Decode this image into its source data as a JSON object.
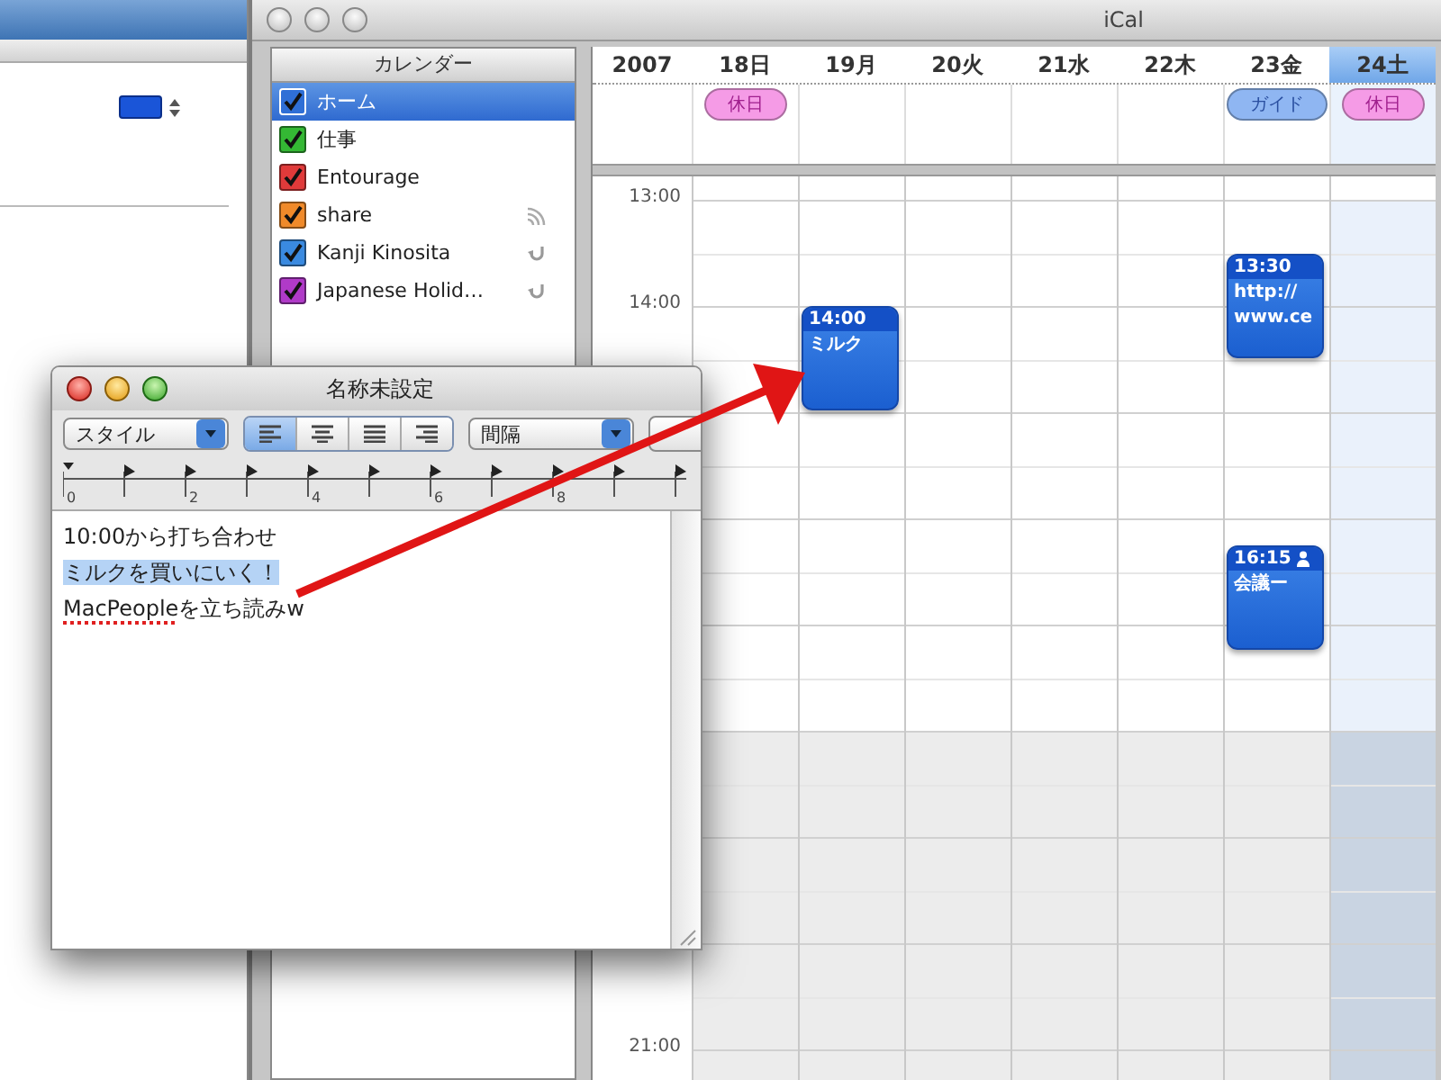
{
  "ical": {
    "window": {
      "title": "iCal"
    },
    "calendars": {
      "header": "カレンダー",
      "items": [
        {
          "name": "ホーム",
          "color": "#2f6fd6",
          "checked": true,
          "selected": true,
          "kind": "local"
        },
        {
          "name": "仕事",
          "color": "#34b834",
          "checked": true,
          "selected": false,
          "kind": "local"
        },
        {
          "name": "Entourage",
          "color": "#e03a3a",
          "checked": true,
          "selected": false,
          "kind": "local"
        },
        {
          "name": "share",
          "color": "#f08a2a",
          "checked": true,
          "selected": false,
          "kind": "published"
        },
        {
          "name": "Kanji Kinosita",
          "color": "#3a8ae0",
          "checked": true,
          "selected": false,
          "kind": "subscribed"
        },
        {
          "name": "Japanese Holid…",
          "color": "#b03ac8",
          "checked": true,
          "selected": false,
          "kind": "subscribed"
        }
      ]
    },
    "week": {
      "year": "2007",
      "days": [
        {
          "label": "18日",
          "selected": false,
          "all_day": [
            {
              "title": "休日",
              "color": "#f59be6"
            }
          ]
        },
        {
          "label": "19月",
          "selected": false,
          "events": [
            {
              "time": "14:00",
              "title": "ミルク",
              "attendees": false
            }
          ]
        },
        {
          "label": "20火",
          "selected": false
        },
        {
          "label": "21水",
          "selected": false
        },
        {
          "label": "22木",
          "selected": false
        },
        {
          "label": "23金",
          "selected": false,
          "all_day": [
            {
              "title": "ガイド",
              "color": "#8fb6f2"
            }
          ],
          "events": [
            {
              "time": "13:30",
              "title": "http://\nwww.ce",
              "attendees": false
            },
            {
              "time": "16:15",
              "title": "会議ー",
              "attendees": true
            }
          ]
        },
        {
          "label": "24土",
          "selected": true,
          "all_day": [
            {
              "title": "休日",
              "color": "#f59be6"
            }
          ]
        }
      ],
      "hours": [
        {
          "label": "13:00",
          "working": true
        },
        {
          "label": "14:00",
          "working": true
        },
        {
          "working": true
        },
        {
          "working": true
        },
        {
          "working": true
        },
        {
          "working": false
        },
        {
          "working": false
        },
        {
          "working": false
        },
        {
          "label": "21:00",
          "working": false
        }
      ]
    }
  },
  "textedit": {
    "window": {
      "title": "名称未設定"
    },
    "toolbar": {
      "style_popup": "スタイル",
      "alignment": [
        {
          "kind": "left",
          "selected": true
        },
        {
          "kind": "center",
          "selected": false
        },
        {
          "kind": "justify",
          "selected": false
        },
        {
          "kind": "right",
          "selected": false
        }
      ],
      "spacing_popup": "間隔"
    },
    "ruler": {
      "numbers": [
        "0",
        "2",
        "4",
        "6",
        "8"
      ]
    },
    "lines": [
      {
        "selected": false,
        "parts": [
          {
            "text": "10:00から打ち合わせ",
            "misspelled": false
          }
        ]
      },
      {
        "selected": true,
        "parts": [
          {
            "text": "ミルクを買いにいく！",
            "misspelled": false
          }
        ]
      },
      {
        "selected": false,
        "parts": [
          {
            "text": "MacPeople",
            "misspelled": true
          },
          {
            "text": "を立ち読みw",
            "misspelled": false
          }
        ]
      }
    ]
  }
}
